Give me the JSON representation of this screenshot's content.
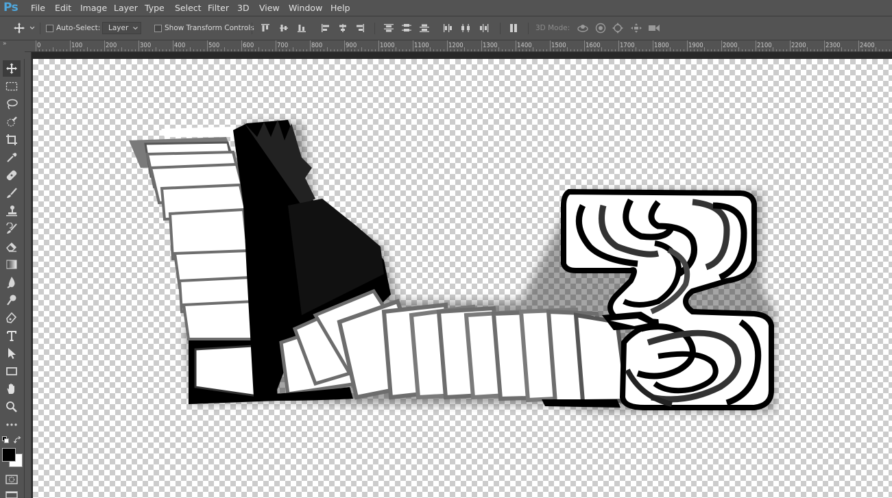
{
  "app": {
    "logo": "Ps"
  },
  "menu": [
    "File",
    "Edit",
    "Image",
    "Layer",
    "Type",
    "Select",
    "Filter",
    "3D",
    "View",
    "Window",
    "Help"
  ],
  "options": {
    "auto_select_label": "Auto-Select:",
    "auto_select_value": "Layer",
    "show_transform_label": "Show Transform Controls",
    "mode_label": "3D Mode:"
  },
  "ruler": {
    "labels": [
      "0",
      "100",
      "200",
      "300",
      "400",
      "500",
      "600",
      "700",
      "800",
      "900",
      "1000",
      "1100",
      "1200",
      "1300",
      "1400",
      "1500",
      "1600",
      "1700",
      "1800",
      "1900",
      "2000",
      "2100",
      "2200",
      "2300",
      "2400"
    ]
  },
  "tools": [
    "move-tool",
    "marquee-tool",
    "lasso-tool",
    "quick-selection-tool",
    "crop-tool",
    "eyedropper-tool",
    "healing-brush-tool",
    "brush-tool",
    "clone-stamp-tool",
    "history-brush-tool",
    "eraser-tool",
    "gradient-tool",
    "blur-tool",
    "dodge-tool",
    "pen-tool",
    "type-tool",
    "path-selection-tool",
    "rectangle-tool",
    "hand-tool",
    "zoom-tool",
    "edit-toolbar"
  ],
  "colors": {
    "foreground": "#000000",
    "background": "#ffffff",
    "ui": "#535353",
    "accent": "#4fa7dd"
  }
}
